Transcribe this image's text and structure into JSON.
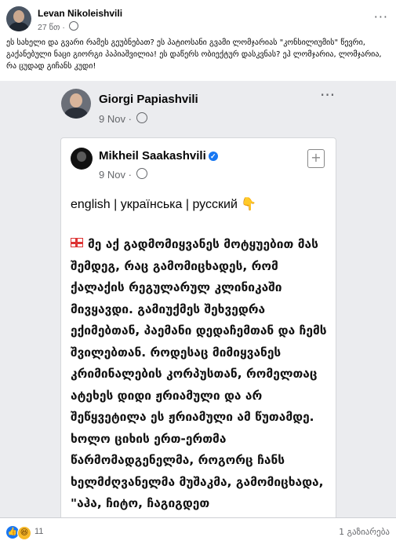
{
  "post": {
    "author": "Levan Nikoleishvili",
    "time": "27 წთ",
    "separator": "·",
    "more": "···",
    "text": "ეს სახელი და გვარი რამეს გეუბნებათ? ეს პატიოსანი გვამი ლომჯარიას \"კონსილიუმის\" წევრი, გაქანებული ნაცი გიორგი პაპიაშვილია! ეს დაწერს ობიექტურ დასკვნას? ეჰ ლომჯარია, ლომჯარია, რა ცუდად გიჩანს კუდი!"
  },
  "screenshot": {
    "author": "Giorgi Papiashvili",
    "date": "9 Nov",
    "separator": "·",
    "more": "···",
    "card": {
      "author": "Mikheil Saakashvili",
      "verified": "✓",
      "date": "9 Nov",
      "separator": "·",
      "save": "+",
      "languages": "english | українська | русский 👇",
      "body": "მე აქ გადმომიყვანეს მოტყუებით მას შემდეგ, რაც გამომიცხადეს, რომ ქალაქის რეგულარულ კლინიკაში მივყავდი. გამიუქმეს შეხვედრა ექიმებთან, პაემანი დედაჩემთან და ჩემს შვილებთან. როდესაც მიმიყვანეს კრიმინალების კორპუსთან, რომელთაც ატეხეს დიდი ჟრიამული და არ შეწყვეტილა ეს ჟრიამული ამ წუთამდე. ხოლო ციხის ერთ-ერთმა წარმომადგენელმა, როგორც ჩანს ხელმძღვანელმა მუშაკმა, გამომიცხადა, \"აჰა, ჩიტო, ჩაგიგდეთ"
    }
  },
  "footer": {
    "like_icon": "👍",
    "haha_icon": "😆",
    "reaction_count": "11",
    "shares": "1 გაზიარება"
  }
}
